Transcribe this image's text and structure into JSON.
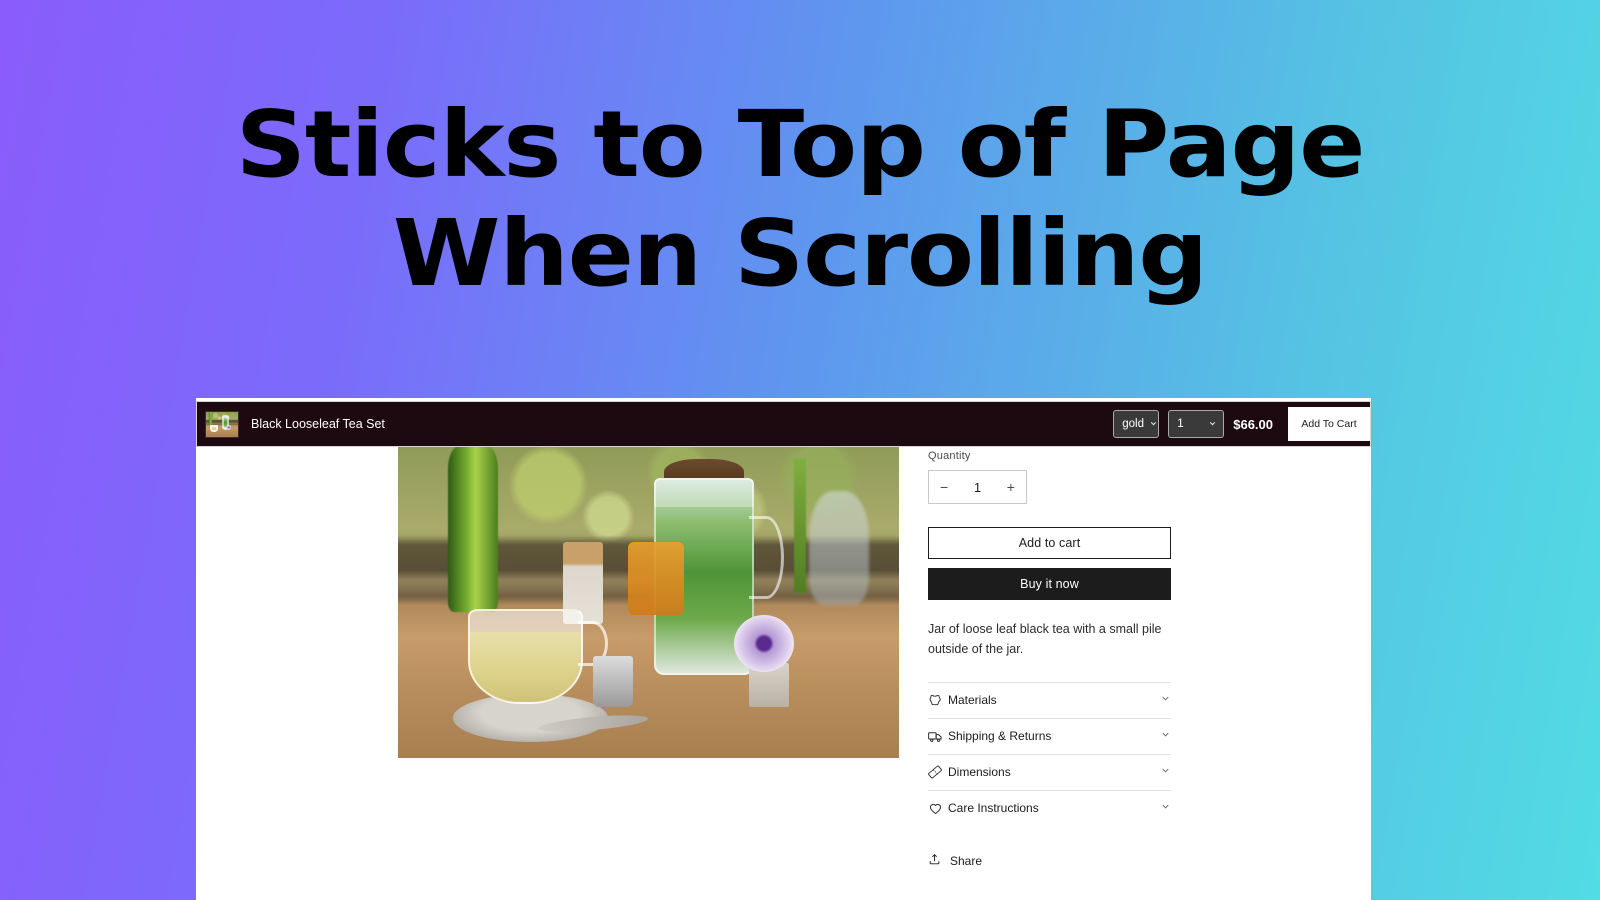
{
  "hero": {
    "headline": "Sticks to Top of Page When Scrolling",
    "gradient_from": "#8a5cfb",
    "gradient_to": "#52dce4"
  },
  "sticky_bar": {
    "background": "#1d0a11",
    "product_title": "Black Looseleaf Tea Set",
    "thumbnail_alt": "product-thumbnail",
    "variant_select": {
      "value": "gold",
      "caret": "⌄"
    },
    "quantity_select": {
      "value": "1",
      "caret": "⌄"
    },
    "price": "$66.00",
    "cta_label": "Add To Cart"
  },
  "product": {
    "image_alt": "Black looseleaf tea set on a wooden table by a window",
    "variants": [
      {
        "label": "",
        "selected": true
      },
      {
        "label": "",
        "selected": false
      },
      {
        "label": "",
        "selected": false
      }
    ],
    "quantity": {
      "label": "Quantity",
      "decrement": "−",
      "value": "1",
      "increment": "+"
    },
    "add_to_cart_label": "Add to cart",
    "buy_now_label": "Buy it now",
    "description": "Jar of loose leaf black tea with a small pile outside of the jar.",
    "accordions": [
      {
        "label": "Materials",
        "icon": "hide-icon",
        "chevron": "⌄"
      },
      {
        "label": "Shipping & Returns",
        "icon": "truck-icon",
        "chevron": "⌄"
      },
      {
        "label": "Dimensions",
        "icon": "ruler-icon",
        "chevron": "⌄"
      },
      {
        "label": "Care Instructions",
        "icon": "heart-icon",
        "chevron": "⌄"
      }
    ],
    "share": {
      "label": "Share",
      "icon": "share-icon"
    }
  }
}
